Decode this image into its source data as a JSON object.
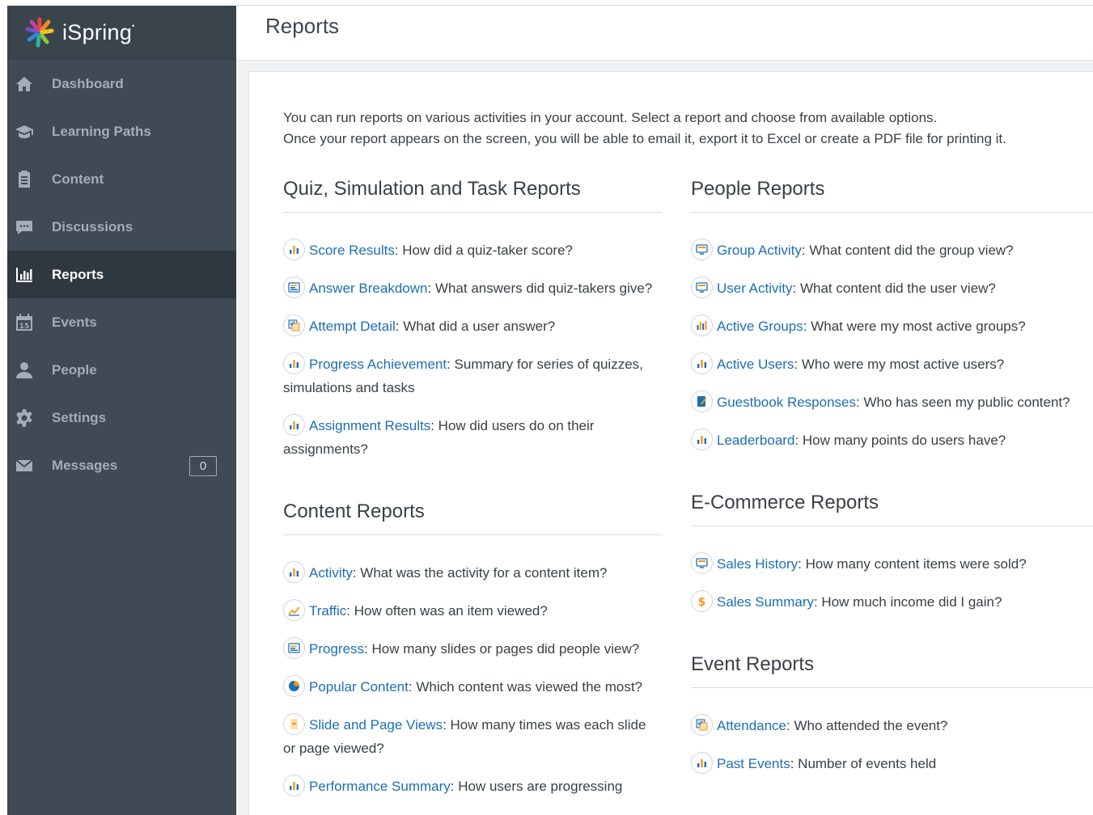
{
  "app": {
    "logo_text": "iSpring",
    "page_title": "Reports"
  },
  "sidebar": {
    "items": [
      {
        "label": "Dashboard",
        "icon": "home-icon"
      },
      {
        "label": "Learning Paths",
        "icon": "graduation-cap-icon"
      },
      {
        "label": "Content",
        "icon": "content-clipboard-icon"
      },
      {
        "label": "Discussions",
        "icon": "discussion-bubble-icon"
      },
      {
        "label": "Reports",
        "icon": "bar-chart-icon",
        "active": true
      },
      {
        "label": "Events",
        "icon": "calendar-icon",
        "calendar_day": "15"
      },
      {
        "label": "People",
        "icon": "person-icon"
      },
      {
        "label": "Settings",
        "icon": "gear-icon"
      },
      {
        "label": "Messages",
        "icon": "envelope-icon",
        "badge": "0"
      }
    ]
  },
  "intro": {
    "line1": "You can run reports on various activities in your account. Select a report and choose from available options.",
    "line2": "Once your report appears on the screen, you will be able to email it, export it to Excel or create a PDF file for printing it."
  },
  "sections": {
    "quiz": {
      "title": "Quiz, Simulation and Task Reports",
      "reports": [
        {
          "name": "Score Results",
          "desc": ": How did a quiz-taker score?",
          "icon": "bar-chart-icon"
        },
        {
          "name": "Answer Breakdown",
          "desc": ": What answers did quiz-takers give?",
          "icon": "list-bars-icon"
        },
        {
          "name": "Attempt Detail",
          "desc": ": What did a user answer?",
          "icon": "attempt-icon"
        },
        {
          "name": "Progress Achievement",
          "desc": ": Summary for series of quizzes, simulations and tasks",
          "icon": "bar-chart-icon"
        },
        {
          "name": "Assignment Results",
          "desc": ": How did users do on their assignments?",
          "icon": "bar-chart-icon"
        }
      ]
    },
    "content": {
      "title": "Content Reports",
      "reports": [
        {
          "name": "Activity",
          "desc": ": What was the activity for a content item?",
          "icon": "bar-chart-icon"
        },
        {
          "name": "Traffic",
          "desc": ": How often was an item viewed?",
          "icon": "trend-line-icon"
        },
        {
          "name": "Progress",
          "desc": ": How many slides or pages did people view?",
          "icon": "list-bars-icon"
        },
        {
          "name": "Popular Content",
          "desc": ": Which content was viewed the most?",
          "icon": "pie-chart-icon"
        },
        {
          "name": "Slide and Page Views",
          "desc": ": How many times was each slide or page viewed?",
          "icon": "slide-icon"
        },
        {
          "name": "Performance Summary",
          "desc": ": How users are progressing",
          "icon": "bar-chart-icon"
        }
      ]
    },
    "people": {
      "title": "People Reports",
      "reports": [
        {
          "name": "Group Activity",
          "desc": ": What content did the group view?",
          "icon": "monitor-icon"
        },
        {
          "name": "User Activity",
          "desc": ": What content did the user view?",
          "icon": "monitor-icon"
        },
        {
          "name": "Active Groups",
          "desc": ": What were my most active groups?",
          "icon": "multi-bar-icon"
        },
        {
          "name": "Active Users",
          "desc": ": Who were my most active users?",
          "icon": "bar-chart-icon"
        },
        {
          "name": "Guestbook Responses",
          "desc": ": Who has seen my public content?",
          "icon": "guestbook-icon"
        },
        {
          "name": "Leaderboard",
          "desc": ": How many points do users have?",
          "icon": "bar-chart-icon"
        }
      ]
    },
    "ecommerce": {
      "title": "E-Commerce Reports",
      "reports": [
        {
          "name": "Sales History",
          "desc": ": How many content items were sold?",
          "icon": "monitor-icon"
        },
        {
          "name": "Sales Summary",
          "desc": ": How much income did I gain?",
          "icon": "dollar-icon"
        }
      ]
    },
    "events": {
      "title": "Event Reports",
      "reports": [
        {
          "name": "Attendance",
          "desc": ": Who attended the event?",
          "icon": "attempt-icon"
        },
        {
          "name": "Past Events",
          "desc": ": Number of events held",
          "icon": "bar-chart-icon"
        }
      ]
    }
  },
  "colors": {
    "sidebar_bg": "#3f4a54",
    "sidebar_active": "#2f373f",
    "link": "#1c6fb5",
    "accent_orange": "#f39a1c"
  }
}
